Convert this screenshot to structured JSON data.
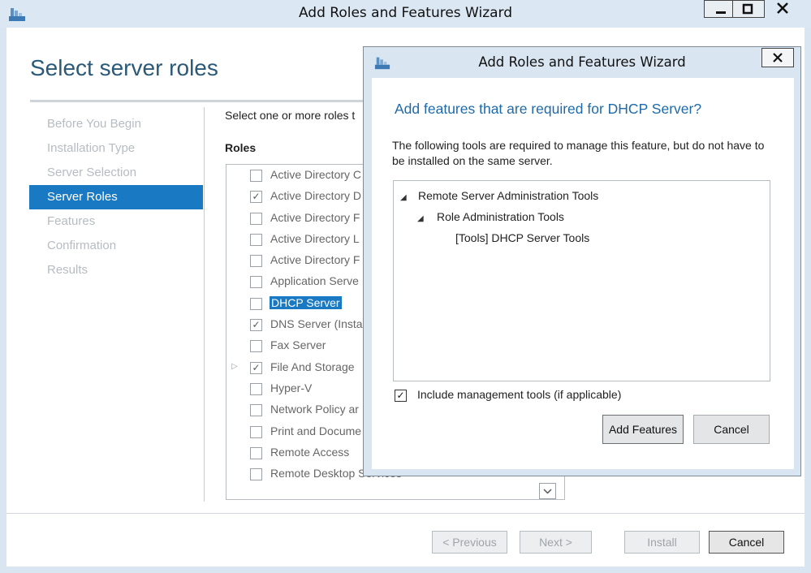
{
  "window": {
    "title": "Add Roles and Features Wizard",
    "page_title": "Select server roles"
  },
  "steps": [
    {
      "label": "Before You Begin",
      "active": false
    },
    {
      "label": "Installation Type",
      "active": false
    },
    {
      "label": "Server Selection",
      "active": false
    },
    {
      "label": "Server Roles",
      "active": true
    },
    {
      "label": "Features",
      "active": false
    },
    {
      "label": "Confirmation",
      "active": false
    },
    {
      "label": "Results",
      "active": false
    }
  ],
  "main": {
    "instruction": "Select one or more roles t",
    "roles_label": "Roles",
    "roles": [
      {
        "label": "Active Directory C",
        "checked": false,
        "expander": false,
        "selected": false
      },
      {
        "label": "Active Directory D",
        "checked": true,
        "expander": false,
        "selected": false
      },
      {
        "label": "Active Directory F",
        "checked": false,
        "expander": false,
        "selected": false
      },
      {
        "label": "Active Directory L",
        "checked": false,
        "expander": false,
        "selected": false
      },
      {
        "label": "Active Directory F",
        "checked": false,
        "expander": false,
        "selected": false
      },
      {
        "label": "Application Serve",
        "checked": false,
        "expander": false,
        "selected": false
      },
      {
        "label": "DHCP Server",
        "checked": false,
        "expander": false,
        "selected": true
      },
      {
        "label": "DNS Server (Insta",
        "checked": true,
        "expander": false,
        "selected": false
      },
      {
        "label": "Fax Server",
        "checked": false,
        "expander": false,
        "selected": false
      },
      {
        "label": "File And Storage",
        "checked": true,
        "expander": true,
        "selected": false
      },
      {
        "label": "Hyper-V",
        "checked": false,
        "expander": false,
        "selected": false
      },
      {
        "label": "Network Policy ar",
        "checked": false,
        "expander": false,
        "selected": false
      },
      {
        "label": "Print and Docume",
        "checked": false,
        "expander": false,
        "selected": false
      },
      {
        "label": "Remote Access",
        "checked": false,
        "expander": false,
        "selected": false
      },
      {
        "label": "Remote Desktop Services",
        "checked": false,
        "expander": false,
        "selected": false
      }
    ]
  },
  "footer": {
    "previous_label": "< Previous",
    "next_label": "Next >",
    "install_label": "Install",
    "cancel_label": "Cancel"
  },
  "dialog": {
    "title": "Add Roles and Features Wizard",
    "heading": "Add features that are required for DHCP Server?",
    "description": "The following tools are required to manage this feature, but do not have to be installed on the same server.",
    "tree": [
      {
        "label": "Remote Server Administration Tools",
        "level": 0,
        "expanded": true
      },
      {
        "label": "Role Administration Tools",
        "level": 1,
        "expanded": true
      },
      {
        "label": "[Tools] DHCP Server Tools",
        "level": 2,
        "expanded": false
      }
    ],
    "include_tools_label": "Include management tools (if applicable)",
    "include_tools_checked": true,
    "add_features_label": "Add Features",
    "cancel_label": "Cancel"
  },
  "colors": {
    "accent": "#1979c3",
    "heading": "#2b5a78",
    "dialog_heading": "#1e6aa8"
  },
  "icons": [
    "wizard-app-icon",
    "minimize-icon",
    "maximize-icon",
    "close-icon",
    "checkbox-check-icon",
    "expander-arrow-icon",
    "scroll-down-icon"
  ]
}
